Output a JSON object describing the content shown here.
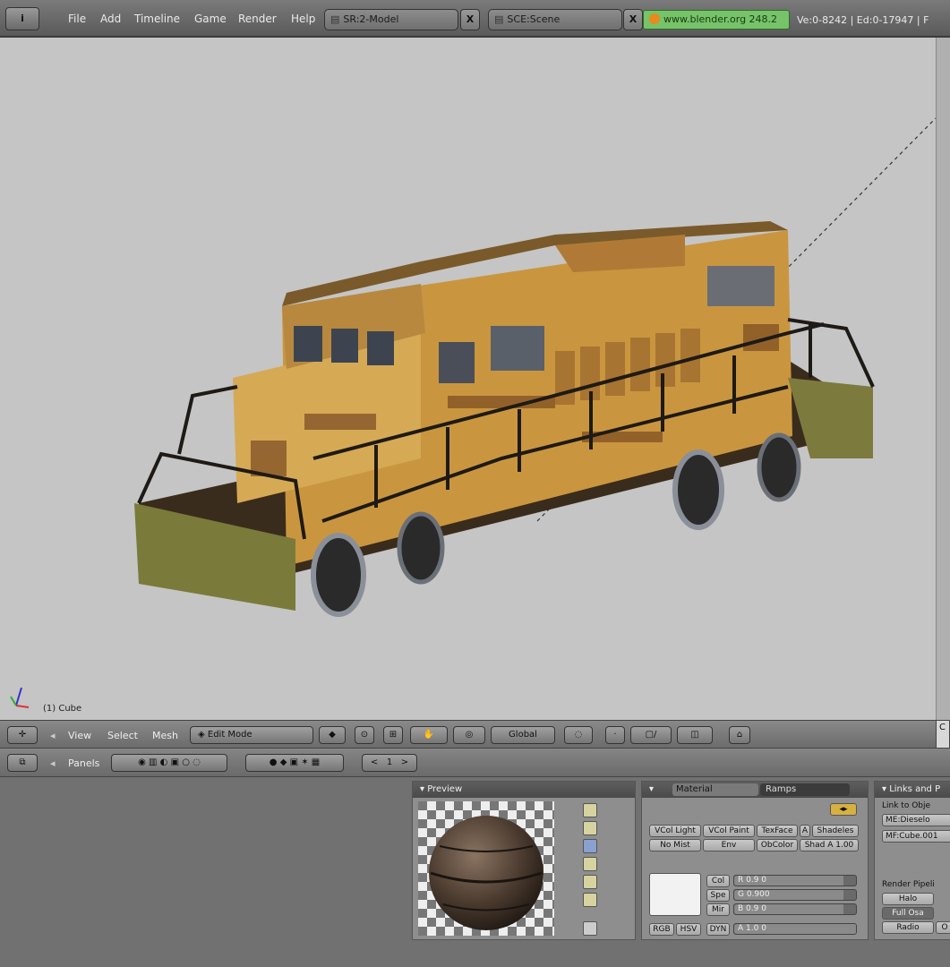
{
  "topbar": {
    "editor_icon": "i",
    "menus": [
      "File",
      "Add",
      "Timeline",
      "Game",
      "Render",
      "Help"
    ],
    "screen": {
      "label": "SR:2-Model",
      "icon": "screen-icon"
    },
    "scene": {
      "label": "SCE:Scene",
      "icon": "scene-icon"
    },
    "close_glyph": "X",
    "website": "www.blender.org 248.2",
    "stats": "Ve:0-8242 | Ed:0-17947 | F"
  },
  "viewport": {
    "object_label": "(1) Cube",
    "background": "#c5c5c5"
  },
  "view_header": {
    "menus": [
      "View",
      "Select",
      "Mesh"
    ],
    "mode": "Edit Mode",
    "orientation": "Global",
    "right_stub": "C"
  },
  "buttons_header": {
    "panels_label": "Panels",
    "frame": "1",
    "arrow_left": "<",
    "arrow_right": ">"
  },
  "preview_panel": {
    "title": "Preview"
  },
  "material_panel": {
    "tabs": [
      "Material",
      "Ramps"
    ],
    "toggle_rows": [
      [
        "VCol Light",
        "VCol Paint",
        "TexFace",
        "A",
        "Shadeles"
      ],
      [
        "No Mist",
        "Env",
        "ObColor",
        "Shad A 1.00"
      ]
    ],
    "color_buttons": [
      "Col",
      "Spe",
      "Mir"
    ],
    "sliders": [
      {
        "label": "R 0.9 0",
        "value": 0.9
      },
      {
        "label": "G 0.900",
        "value": 0.9
      },
      {
        "label": "B 0.9 0",
        "value": 0.9
      }
    ],
    "mode_buttons": [
      "RGB",
      "HSV",
      "DYN"
    ],
    "alpha_slider": {
      "label": "A 1.0 0",
      "value": 1.0
    }
  },
  "links_panel": {
    "title": "Links and P",
    "link_to": "Link to Obje",
    "me_field": "ME:Dieselo",
    "mf_field": "MF:Cube.001",
    "render_pipeline": "Render Pipeli",
    "halo": "Halo",
    "full_osa": "Full Osa",
    "radio": "Radio",
    "o_stub": "O"
  },
  "colors": {
    "topbar": "#6a6a6a",
    "website_bg": "#76c36a",
    "viewport_bg": "#c5c5c5",
    "loco_body": "#c99a4a",
    "loco_rust": "#7a4a22"
  }
}
